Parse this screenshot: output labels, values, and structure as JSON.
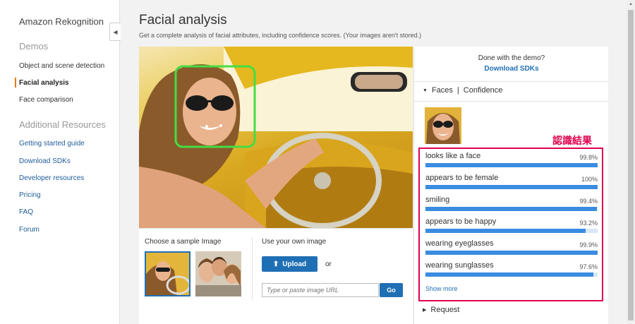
{
  "sidebar": {
    "title": "Amazon Rekognition",
    "demos_heading": "Demos",
    "demos": [
      {
        "label": "Object and scene detection"
      },
      {
        "label": "Facial analysis"
      },
      {
        "label": "Face comparison"
      }
    ],
    "resources_heading": "Additional Resources",
    "resources": [
      {
        "label": "Getting started guide"
      },
      {
        "label": "Download SDKs"
      },
      {
        "label": "Developer resources"
      },
      {
        "label": "Pricing"
      },
      {
        "label": "FAQ"
      },
      {
        "label": "Forum"
      }
    ]
  },
  "header": {
    "title": "Facial analysis",
    "subtitle": "Get a complete analysis of facial attributes, including confidence scores. (Your images aren't stored.)"
  },
  "samples": {
    "choose_label": "Choose a sample Image",
    "own_label": "Use your own image",
    "upload_label": "Upload",
    "or_label": "or",
    "url_placeholder": "Type or paste image URL",
    "go_label": "Go"
  },
  "panel": {
    "done_text": "Done with the demo?",
    "download_link": "Download SDKs",
    "tab_faces": "Faces",
    "tab_separator": "|",
    "tab_confidence": "Confidence",
    "annotation": "認識結果",
    "results": [
      {
        "label": "looks like a face",
        "value": "99.8%",
        "fraction": 0.998
      },
      {
        "label": "appears to be female",
        "value": "100%",
        "fraction": 1.0
      },
      {
        "label": "smiling",
        "value": "99.4%",
        "fraction": 0.994
      },
      {
        "label": "appears to be happy",
        "value": "93.2%",
        "fraction": 0.932
      },
      {
        "label": "wearing eyeglasses",
        "value": "99.9%",
        "fraction": 0.999
      },
      {
        "label": "wearing sunglasses",
        "value": "97.6%",
        "fraction": 0.976
      }
    ],
    "show_more": "Show more",
    "request_tab": "Request"
  },
  "colors": {
    "accent_blue": "#1f6fb5",
    "bar_fill": "#3a8ce0",
    "annotation_red": "#e0004d",
    "face_box_green": "#44dd44"
  },
  "icons": [
    "chevron-left-icon",
    "upload-icon",
    "triangle-down-icon",
    "triangle-right-icon"
  ]
}
